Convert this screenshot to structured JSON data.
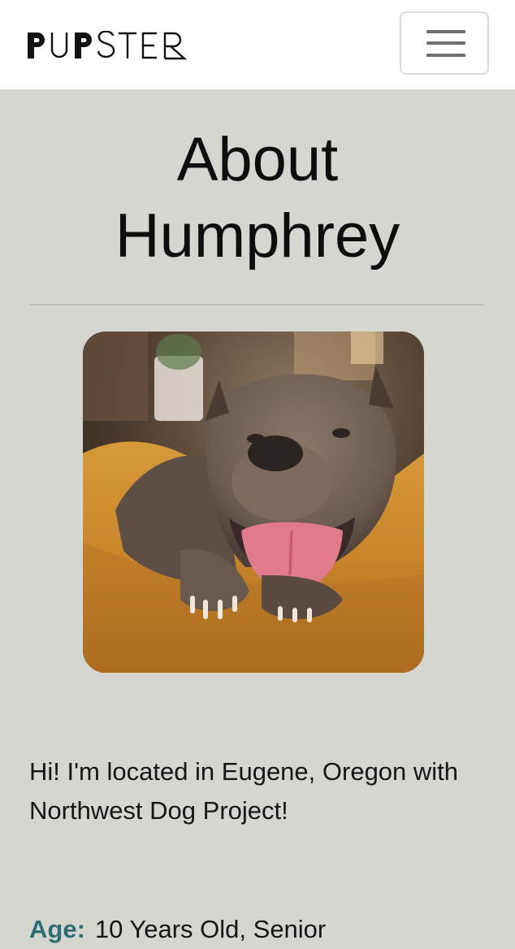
{
  "navbar": {
    "logo_text": "PUPSTER",
    "menu_icon": "hamburger-menu-icon"
  },
  "profile": {
    "title_line1": "About",
    "title_line2": "Humphrey",
    "photo_subject": "Smiling grey pit bull lying on an orange dog bed",
    "intro": "Hi! I'm located in Eugene, Oregon with Northwest Dog Project!",
    "detail_label": "Age:",
    "detail_value": "10 Years Old, Senior"
  },
  "colors": {
    "page_background": "#d6d6d1",
    "navbar_background": "#ffffff",
    "label_accent": "#2f6f73"
  }
}
